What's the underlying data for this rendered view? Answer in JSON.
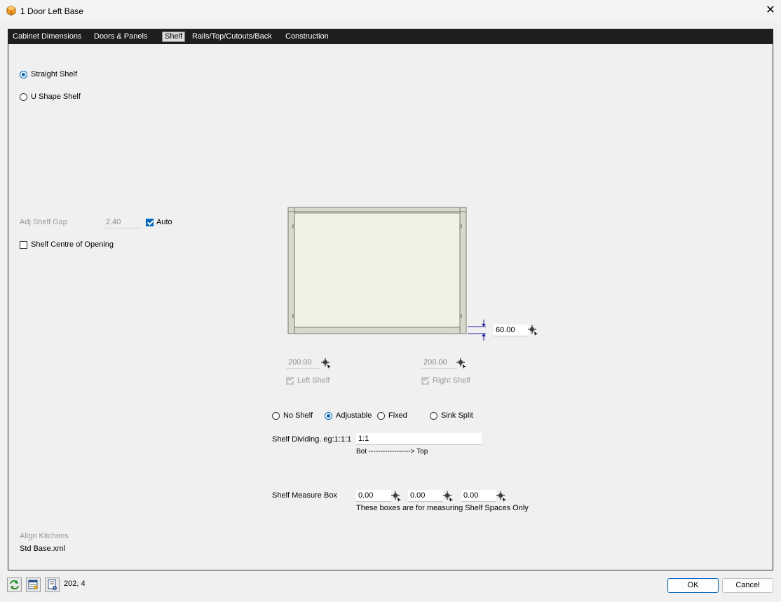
{
  "window": {
    "title": "1 Door Left Base",
    "app_icon": "cabinet-cube-icon",
    "close_icon": "close-icon",
    "close_glyph": "✕"
  },
  "tabs": [
    {
      "label": "Cabinet Dimensions",
      "active": false
    },
    {
      "label": "Doors & Panels",
      "active": false
    },
    {
      "label": "Shelf",
      "active": true
    },
    {
      "label": "Rails/Top/Cutouts/Back",
      "active": false
    },
    {
      "label": "Construction",
      "active": false
    }
  ],
  "shelf_type": {
    "straight": "Straight Shelf",
    "u_shape": "U Shape Shelf",
    "selected": "straight"
  },
  "adj_gap": {
    "label": "Adj Shelf Gap",
    "value": "2.40",
    "auto_label": "Auto",
    "auto_checked": true
  },
  "centre_opening": {
    "label": "Shelf Centre of Opening",
    "checked": false
  },
  "diagram": {
    "bottom_value": "60.00"
  },
  "left_shelf": {
    "value": "200.00",
    "label": "Left Shelf",
    "checked": true
  },
  "right_shelf": {
    "value": "200.00",
    "label": "Right Shelf",
    "checked": true
  },
  "shelf_options": {
    "no_shelf": "No Shelf",
    "adjustable": "Adjustable",
    "fixed": "Fixed",
    "sink_split": "Sink Split",
    "selected": "adjustable"
  },
  "dividing": {
    "label": "Shelf Dividing. eg:1:1:1",
    "value": "1:1",
    "hint": "Bot ------------------> Top"
  },
  "measure": {
    "label": "Shelf Measure Box",
    "values": [
      "0.00",
      "0.00",
      "0.00"
    ],
    "note": "These boxes are for measuring Shelf Spaces Only"
  },
  "footer_info": {
    "company": "Align Kitchens",
    "file": "Std Base.xml"
  },
  "status": {
    "coords": "202, 4"
  },
  "buttons": {
    "ok": "OK",
    "cancel": "Cancel"
  },
  "colors": {
    "accent": "#0067c0",
    "cabinet_fill": "#f2f1e6",
    "cabinet_frame": "#d6d5c8"
  }
}
